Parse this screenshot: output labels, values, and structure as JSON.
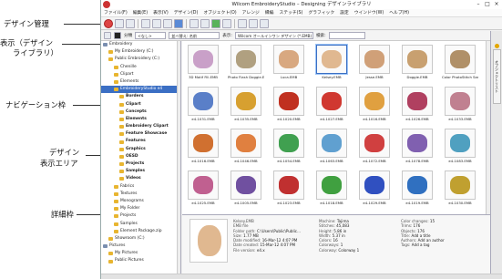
{
  "annotations": {
    "design_management": "デザイン管理",
    "view_library_line1": "表示（デザイン",
    "view_library_line2": "ライブラリ）",
    "navigation_pane": "ナビゲーション枠",
    "design_display_line1": "デザイン",
    "design_display_line2": "表示エリア",
    "details_pane": "詳細枠"
  },
  "window": {
    "title": "Wilcom EmbroideryStudio – Designing  デザインライブラリ",
    "controls": [
      "–",
      "□",
      "×"
    ]
  },
  "menu": [
    "ファイル(F)",
    "編集(E)",
    "表示(V)",
    "デザイン(D)",
    "オブジェクト(O)",
    "アレンジ",
    "縁編",
    "ステッチ(S)",
    "グラフィック",
    "設定",
    "ウインドウ(W)",
    "ヘルプ(H)"
  ],
  "filter": {
    "group_label": "分類",
    "group_value": "<なし>",
    "sort_value": "並べ替え: 名前",
    "show_label": "表示:",
    "show_value": "Wilcom オールインワン デザイン (*.EMB)",
    "search_label": "検索:"
  },
  "nav": {
    "items": [
      {
        "label": "Embroidery",
        "indent": 0,
        "style": "root"
      },
      {
        "label": "My Embroidery (C:)",
        "indent": 1
      },
      {
        "label": "Public Embroidery (C:)",
        "indent": 1
      },
      {
        "label": "Chenille",
        "indent": 2
      },
      {
        "label": "Clipart",
        "indent": 2
      },
      {
        "label": "Elements",
        "indent": 2
      },
      {
        "label": "EmbroideryStudio e4",
        "indent": 2,
        "style": "sel"
      },
      {
        "label": "Borders",
        "indent": 3,
        "style": "bold"
      },
      {
        "label": "Clipart",
        "indent": 3,
        "style": "bold"
      },
      {
        "label": "Concepts",
        "indent": 3,
        "style": "bold"
      },
      {
        "label": "Elements",
        "indent": 3,
        "style": "bold"
      },
      {
        "label": "Embroidery Clipart",
        "indent": 3,
        "style": "bold"
      },
      {
        "label": "Feature Showcase",
        "indent": 3,
        "style": "bold"
      },
      {
        "label": "Features",
        "indent": 3,
        "style": "bold"
      },
      {
        "label": "Graphics",
        "indent": 3,
        "style": "bold"
      },
      {
        "label": "OESD",
        "indent": 3,
        "style": "bold"
      },
      {
        "label": "Projects",
        "indent": 3,
        "style": "bold"
      },
      {
        "label": "Samples",
        "indent": 3,
        "style": "bold"
      },
      {
        "label": "Videos",
        "indent": 3,
        "style": "bold"
      },
      {
        "label": "Fabrics",
        "indent": 2
      },
      {
        "label": "Textures",
        "indent": 2
      },
      {
        "label": "Monograms",
        "indent": 2
      },
      {
        "label": "My Folder",
        "indent": 2
      },
      {
        "label": "Projects",
        "indent": 2
      },
      {
        "label": "Samples",
        "indent": 2
      },
      {
        "label": "Element Package.zip",
        "indent": 2
      },
      {
        "label": "Showroom (C:)",
        "indent": 1
      },
      {
        "label": "Pictures",
        "indent": 0,
        "style": "root"
      },
      {
        "label": "My Pictures",
        "indent": 1
      },
      {
        "label": "Public Pictures",
        "indent": 1
      }
    ]
  },
  "grid": {
    "tiles": [
      {
        "name": "3D Motif Fill.EMB",
        "color": "#c9a0c8"
      },
      {
        "name": "Photo Flash Doggie.EMB",
        "color": "#b0a080"
      },
      {
        "name": "Luca.EMB",
        "color": "#d8a880"
      },
      {
        "name": "Kelsey.EMB",
        "color": "#e0b890",
        "sel": true
      },
      {
        "name": "Jesse.EMB",
        "color": "#d0a078"
      },
      {
        "name": "Doggie.EMB",
        "color": "#c8a070"
      },
      {
        "name": "Color PhotoStitch Sample.EMB",
        "color": "#b09068"
      },
      {
        "name": "e4-1031.EMB",
        "color": "#5a7fc8"
      },
      {
        "name": "e4-1035.EMB",
        "color": "#d7a030"
      },
      {
        "name": "e4-1020.EMB",
        "color": "#c03020"
      },
      {
        "name": "e4-1027.EMB",
        "color": "#d03830"
      },
      {
        "name": "e4-1016.EMB",
        "color": "#e0a040"
      },
      {
        "name": "e4-1026.EMB",
        "color": "#b04060"
      },
      {
        "name": "e4-1033.EMB",
        "color": "#c08090"
      },
      {
        "name": "e4-1016.EMB",
        "color": "#d07030"
      },
      {
        "name": "e4-1046.EMB",
        "color": "#e08040"
      },
      {
        "name": "e4-1054.EMB",
        "color": "#40a050"
      },
      {
        "name": "e4-1063.EMB",
        "color": "#60a0d0"
      },
      {
        "name": "e4-1072.EMB",
        "color": "#d04040"
      },
      {
        "name": "e4-1078.EMB",
        "color": "#8060b0"
      },
      {
        "name": "e4-1083.EMB",
        "color": "#50a0c0"
      },
      {
        "name": "e4-1025.EMB",
        "color": "#c06090"
      },
      {
        "name": "e4-1005.EMB",
        "color": "#7050a0"
      },
      {
        "name": "e4-1023.EMB",
        "color": "#c03030"
      },
      {
        "name": "e4-1018.EMB",
        "color": "#40a040"
      },
      {
        "name": "e4-1029.EMB",
        "color": "#3050c0"
      },
      {
        "name": "e4-1019.EMB",
        "color": "#3070c0"
      },
      {
        "name": "e4-1030.EMB",
        "color": "#c0a030"
      }
    ]
  },
  "details": {
    "col1": [
      {
        "k": "Kelsey.EMB",
        "v": ""
      },
      {
        "k": "EMB file",
        "v": ""
      },
      {
        "k": "Folder path:",
        "v": "C:\\Users\\Public\\Public..."
      },
      {
        "k": "Size:",
        "v": "1.77 MB"
      },
      {
        "k": "Date modified:",
        "v": "16-Mar-12 4:07 PM"
      },
      {
        "k": "Date created:",
        "v": "15-Mar-12 4:07 PM"
      },
      {
        "k": "File version:",
        "v": "e4.x"
      }
    ],
    "col2": [
      {
        "k": "Machine:",
        "v": "Tajima"
      },
      {
        "k": "Stitches:",
        "v": "45,083"
      },
      {
        "k": "Height:",
        "v": "5.86 in"
      },
      {
        "k": "Width:",
        "v": "5.37 in"
      },
      {
        "k": "Colors:",
        "v": "16"
      },
      {
        "k": "Colorways:",
        "v": "1"
      },
      {
        "k": "Colorway:",
        "v": "Colorway 1"
      }
    ],
    "col3": [
      {
        "k": "Color changes:",
        "v": "15"
      },
      {
        "k": "Trims:",
        "v": "176"
      },
      {
        "k": "Objects:",
        "v": "176"
      },
      {
        "k": "Title:",
        "v": "Add a title"
      },
      {
        "k": "Authors:",
        "v": "Add an author"
      },
      {
        "k": "Tags:",
        "v": "Add a tag"
      }
    ]
  },
  "right_panel": {
    "tab_label": "オブジェクトリスト"
  }
}
